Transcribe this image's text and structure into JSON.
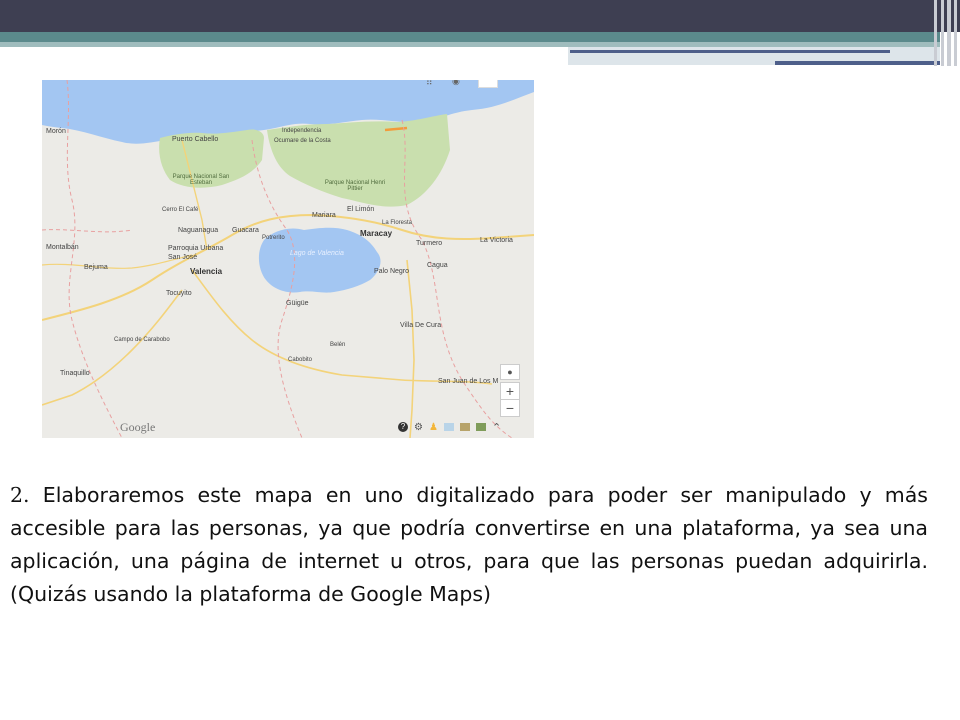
{
  "map": {
    "places": {
      "moron": "Morón",
      "puerto_cabello": "Puerto Cabello",
      "independencia": "Independencia",
      "ocumare": "Ocumare de la Costa",
      "pn_san_esteban": "Parque Nacional San Esteban",
      "pn_henri_pittier": "Parque Nacional Henri Pittier",
      "cerro_el_cafe": "Cerro El Café",
      "naguanagua": "Naguanagua",
      "guacara": "Guacara",
      "mariara": "Mariara",
      "el_limon": "El Limón",
      "la_floresta": "La Floresta",
      "maracay": "Maracay",
      "turmero": "Turmero",
      "la_victoria": "La Victoria",
      "montalban": "Montalbán",
      "bejuma": "Bejuma",
      "parroquia_urbana": "Parroquia Urbana San José",
      "valencia": "Valencia",
      "potrerito": "Potrerito",
      "lago": "Lago de Valencia",
      "palo_negro": "Palo Negro",
      "cagua": "Cagua",
      "tocuyito": "Tocuyito",
      "guigue": "Güigüe",
      "villa_de_cura": "Villa De Cura",
      "campo_carabobo": "Campo de Carabobo",
      "belen": "Belén",
      "cabobito": "Cabobito",
      "tinaquillo": "Tinaquillo",
      "san_juan": "San Juan de Los M"
    },
    "controls": {
      "zoom_in": "+",
      "zoom_out": "−",
      "expand": "⌃"
    },
    "google_logo": "Google",
    "icons": {
      "help": "help-icon",
      "settings": "gear-icon",
      "pegman": "pegman-icon",
      "locate": "locate-icon"
    }
  },
  "body": {
    "number": "2.",
    "text": "Elaboraremos este mapa en uno digitalizado para poder ser manipulado y más accesible para las personas, ya que podría convertirse en una plataforma, ya sea una aplicación, una página de internet u otros, para que las personas puedan adquirirla. (Quizás usando la plataforma de Google Maps)"
  }
}
